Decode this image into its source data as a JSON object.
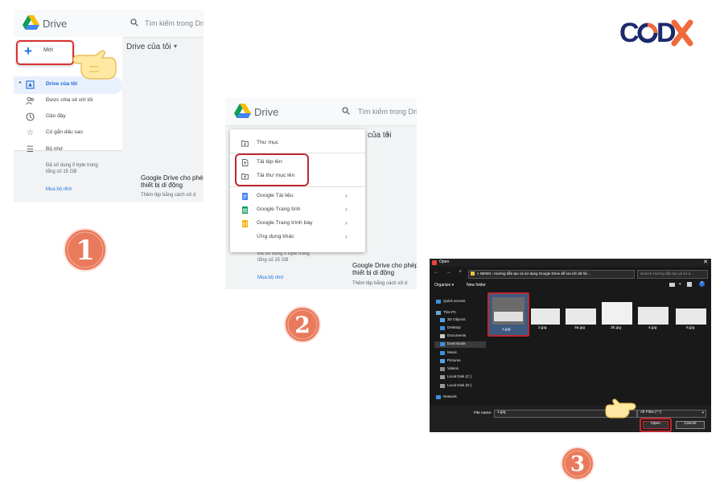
{
  "logo": {
    "text": "CoDX",
    "colors": {
      "c": "#1b2a6b",
      "o_dark": "#1b2a6b",
      "o_light": "#f06a3c",
      "d": "#1b2a6b",
      "x": "#f06a3c"
    }
  },
  "panel1": {
    "app_name": "Drive",
    "search_placeholder": "Tìm kiếm trong Drive",
    "main_heading": "Drive của tôi",
    "new_button": "Mới",
    "sidebar": [
      {
        "label": "Drive của tôi",
        "icon": "my-drive-icon",
        "active": true
      },
      {
        "label": "Được chia sẻ với tôi",
        "icon": "shared-icon",
        "active": false
      },
      {
        "label": "Gần đây",
        "icon": "recent-icon",
        "active": false
      },
      {
        "label": "Có gắn dấu sao",
        "icon": "star-icon",
        "active": false
      }
    ],
    "storage_label": "Bộ nhớ",
    "storage_usage_line1": "Đã sử dụng 0 byte trong",
    "storage_usage_line2": "tổng số 15 GB",
    "buy_storage": "Mua bộ nhớ",
    "promo_line1": "Google Drive cho phép",
    "promo_line2": "thiết bị di động",
    "promo_sub": "Thêm tệp bằng cách sử d"
  },
  "panel2": {
    "app_name": "Drive",
    "search_placeholder": "Tìm kiếm trong Drive",
    "main_heading_fragment": "của tôi",
    "menu": {
      "folder": "Thư mục",
      "upload_file": "Tải tệp lên",
      "upload_folder": "Tải thư mục lên",
      "apps": [
        {
          "label": "Google Tài liệu",
          "icon": "docs-icon",
          "color": "#4285f4"
        },
        {
          "label": "Google Trang tính",
          "icon": "sheets-icon",
          "color": "#0f9d58"
        },
        {
          "label": "Google Trang trình bày",
          "icon": "slides-icon",
          "color": "#f4b400"
        }
      ],
      "more": "Ứng dụng khác",
      "chevron": "›"
    },
    "storage_usage_line1": "Đã sử dụng 0 byte trong",
    "storage_usage_line2": "tổng số 15 GB",
    "buy_storage": "Mua bộ nhớ",
    "promo_line1": "Google Drive cho phép",
    "promo_line2": "thiết bị di động",
    "promo_sub": "Thêm tệp bằng cách sử d"
  },
  "panel3": {
    "title": "Open",
    "close": "✕",
    "address": "« NEWS › Hướng dẫn tạo và sử dụng Google Drive để lưu trữ dữ liệ...",
    "search_placeholder": "Search Hướng dẫn tạo và sử d...",
    "organize": "Organize ▾",
    "new_folder": "New folder",
    "nav": [
      {
        "label": "Quick access",
        "color": "#3d8fe0"
      },
      {
        "label": "This PC",
        "color": "#6aa6d6"
      },
      {
        "label": "3D Objects",
        "color": "#5aa0e6"
      },
      {
        "label": "Desktop",
        "color": "#3d8fe0"
      },
      {
        "label": "Documents",
        "color": "#c9c9c9"
      },
      {
        "label": "Downloads",
        "color": "#3d8fe0"
      },
      {
        "label": "Music",
        "color": "#3d8fe0"
      },
      {
        "label": "Pictures",
        "color": "#5aa0e6"
      },
      {
        "label": "Videos",
        "color": "#8a8a8a"
      },
      {
        "label": "Local Disk (C:)",
        "color": "#9a9a9a"
      },
      {
        "label": "Local Disk (D:)",
        "color": "#9a9a9a"
      },
      {
        "label": "Network",
        "color": "#3d8fe0"
      }
    ],
    "files": [
      "1.jpg",
      "2.jpg",
      "3a.jpg",
      "3b.jpg",
      "4.jpg",
      "5.jpg"
    ],
    "file_name_label": "File name:",
    "file_name_value": "1.jpg",
    "file_type": "All Files (*.*)",
    "open_button": "Open",
    "cancel_button": "Cancel"
  },
  "steps": [
    "1",
    "2",
    "3"
  ],
  "colors": {
    "step_fill": "#ea7a5c",
    "highlight_red": "#c0282d"
  }
}
